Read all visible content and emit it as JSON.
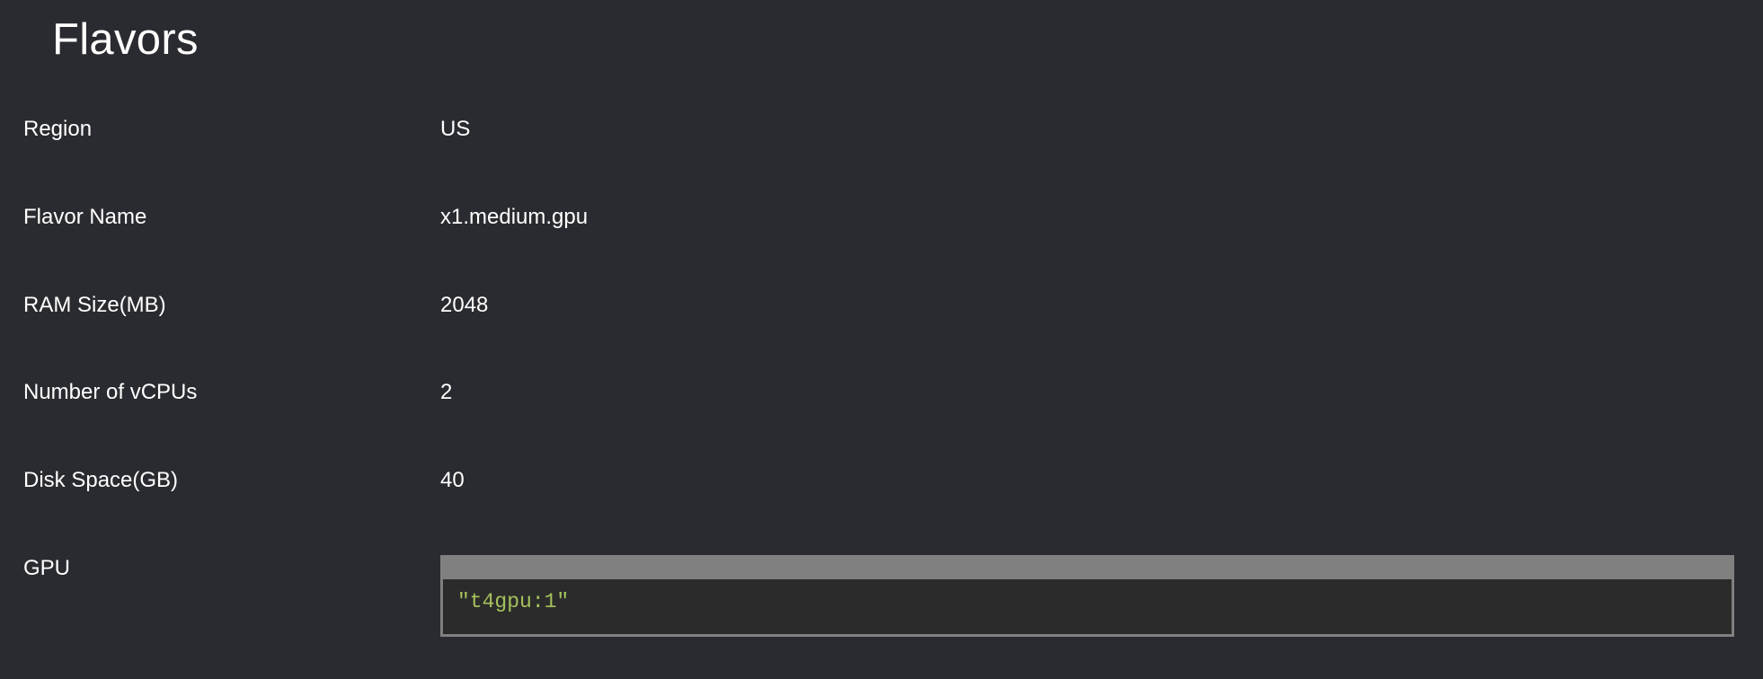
{
  "page": {
    "title": "Flavors"
  },
  "details": [
    {
      "label": "Region",
      "value": "US"
    },
    {
      "label": "Flavor Name",
      "value": "x1.medium.gpu"
    },
    {
      "label": "RAM Size(MB)",
      "value": "2048"
    },
    {
      "label": "Number of vCPUs",
      "value": "2"
    },
    {
      "label": "Disk Space(GB)",
      "value": "40"
    },
    {
      "label": "GPU",
      "value": "\"t4gpu:1\""
    }
  ],
  "colors": {
    "background": "#2a2b30",
    "text": "#ffffff",
    "code_header": "#808080",
    "code_background": "#2b2b2b",
    "code_string": "#a5c25c"
  }
}
